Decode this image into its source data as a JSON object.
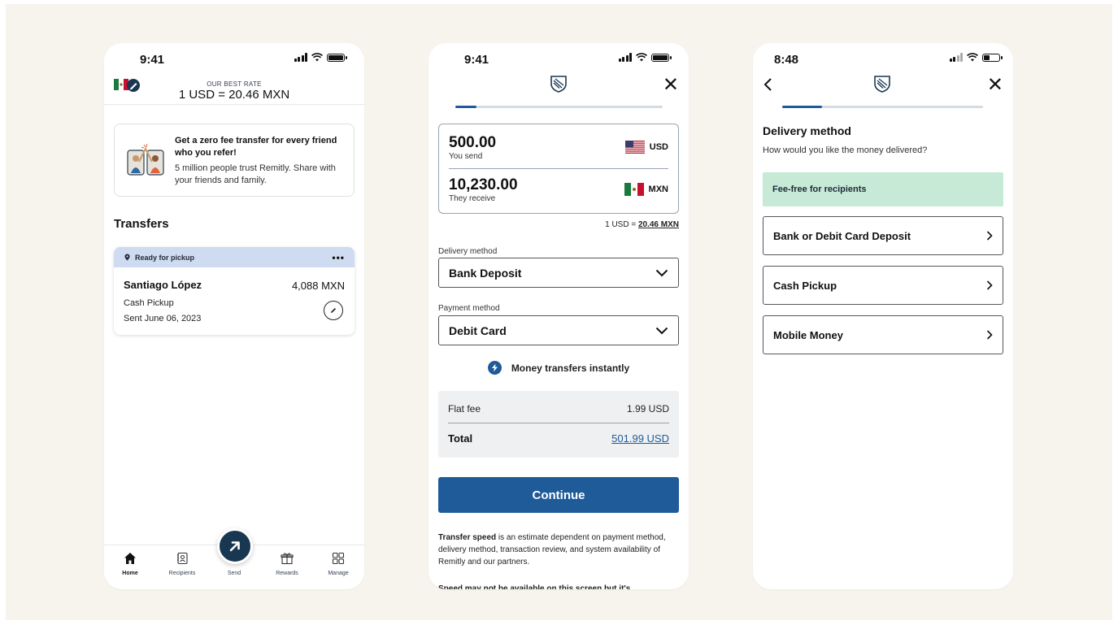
{
  "colors": {
    "background": "#f7f4ee",
    "brand_blue": "#1f5b99",
    "navy": "#193750",
    "status_banner": "#cfdbf1",
    "fee_free_green": "#c6ead6"
  },
  "home_screen": {
    "status_time": "9:41",
    "rate_caption": "OUR BEST RATE",
    "rate_value": "1 USD = 20.46 MXN",
    "referral": {
      "title": "Get a zero fee transfer for every friend who you refer!",
      "body": "5 million people trust Remitly. Share with your friends and family.",
      "illustration_icon": "high-five-illustration"
    },
    "transfers_heading": "Transfers",
    "transfer": {
      "status": "Ready for pickup",
      "more_label": "•••",
      "recipient": "Santiago López",
      "amount": "4,088 MXN",
      "method": "Cash Pickup",
      "date": "Sent June 06, 2023"
    },
    "tabs": [
      {
        "label": "Home",
        "icon": "home-icon",
        "active": true
      },
      {
        "label": "Recipients",
        "icon": "contacts-icon"
      },
      {
        "label": "Send",
        "icon": "send-arrow-icon"
      },
      {
        "label": "Rewards",
        "icon": "gift-icon"
      },
      {
        "label": "Manage",
        "icon": "grid-icon"
      }
    ]
  },
  "send_screen": {
    "status_time": "9:41",
    "progress": 0.1,
    "send_amount": "500.00",
    "send_label": "You send",
    "send_currency": "USD",
    "receive_amount": "10,230.00",
    "receive_label": "They receive",
    "receive_currency": "MXN",
    "rate_prefix": "1 USD = ",
    "rate_value": "20.46 MXN",
    "delivery_label": "Delivery method",
    "delivery_value": "Bank Deposit",
    "payment_label": "Payment method",
    "payment_value": "Debit Card",
    "instant_text": "Money transfers instantly",
    "fee_label": "Flat fee",
    "fee_value": "1.99 USD",
    "total_label": "Total",
    "total_value": "501.99 USD",
    "continue_label": "Continue",
    "disclaimer_bold": "Transfer speed",
    "disclaimer_text": " is an estimate dependent on payment method, delivery method, transaction review, and system availability of Remitly and our partners.",
    "disclaimer_cut": "Speed may not be available on this screen but it's"
  },
  "delivery_screen": {
    "status_time": "8:48",
    "progress": 0.2,
    "title": "Delivery method",
    "subtitle": "How would you like the money delivered?",
    "fee_free_banner": "Fee-free for recipients",
    "options": [
      {
        "label": "Bank or Debit Card Deposit"
      },
      {
        "label": "Cash Pickup"
      },
      {
        "label": "Mobile Money"
      }
    ]
  }
}
